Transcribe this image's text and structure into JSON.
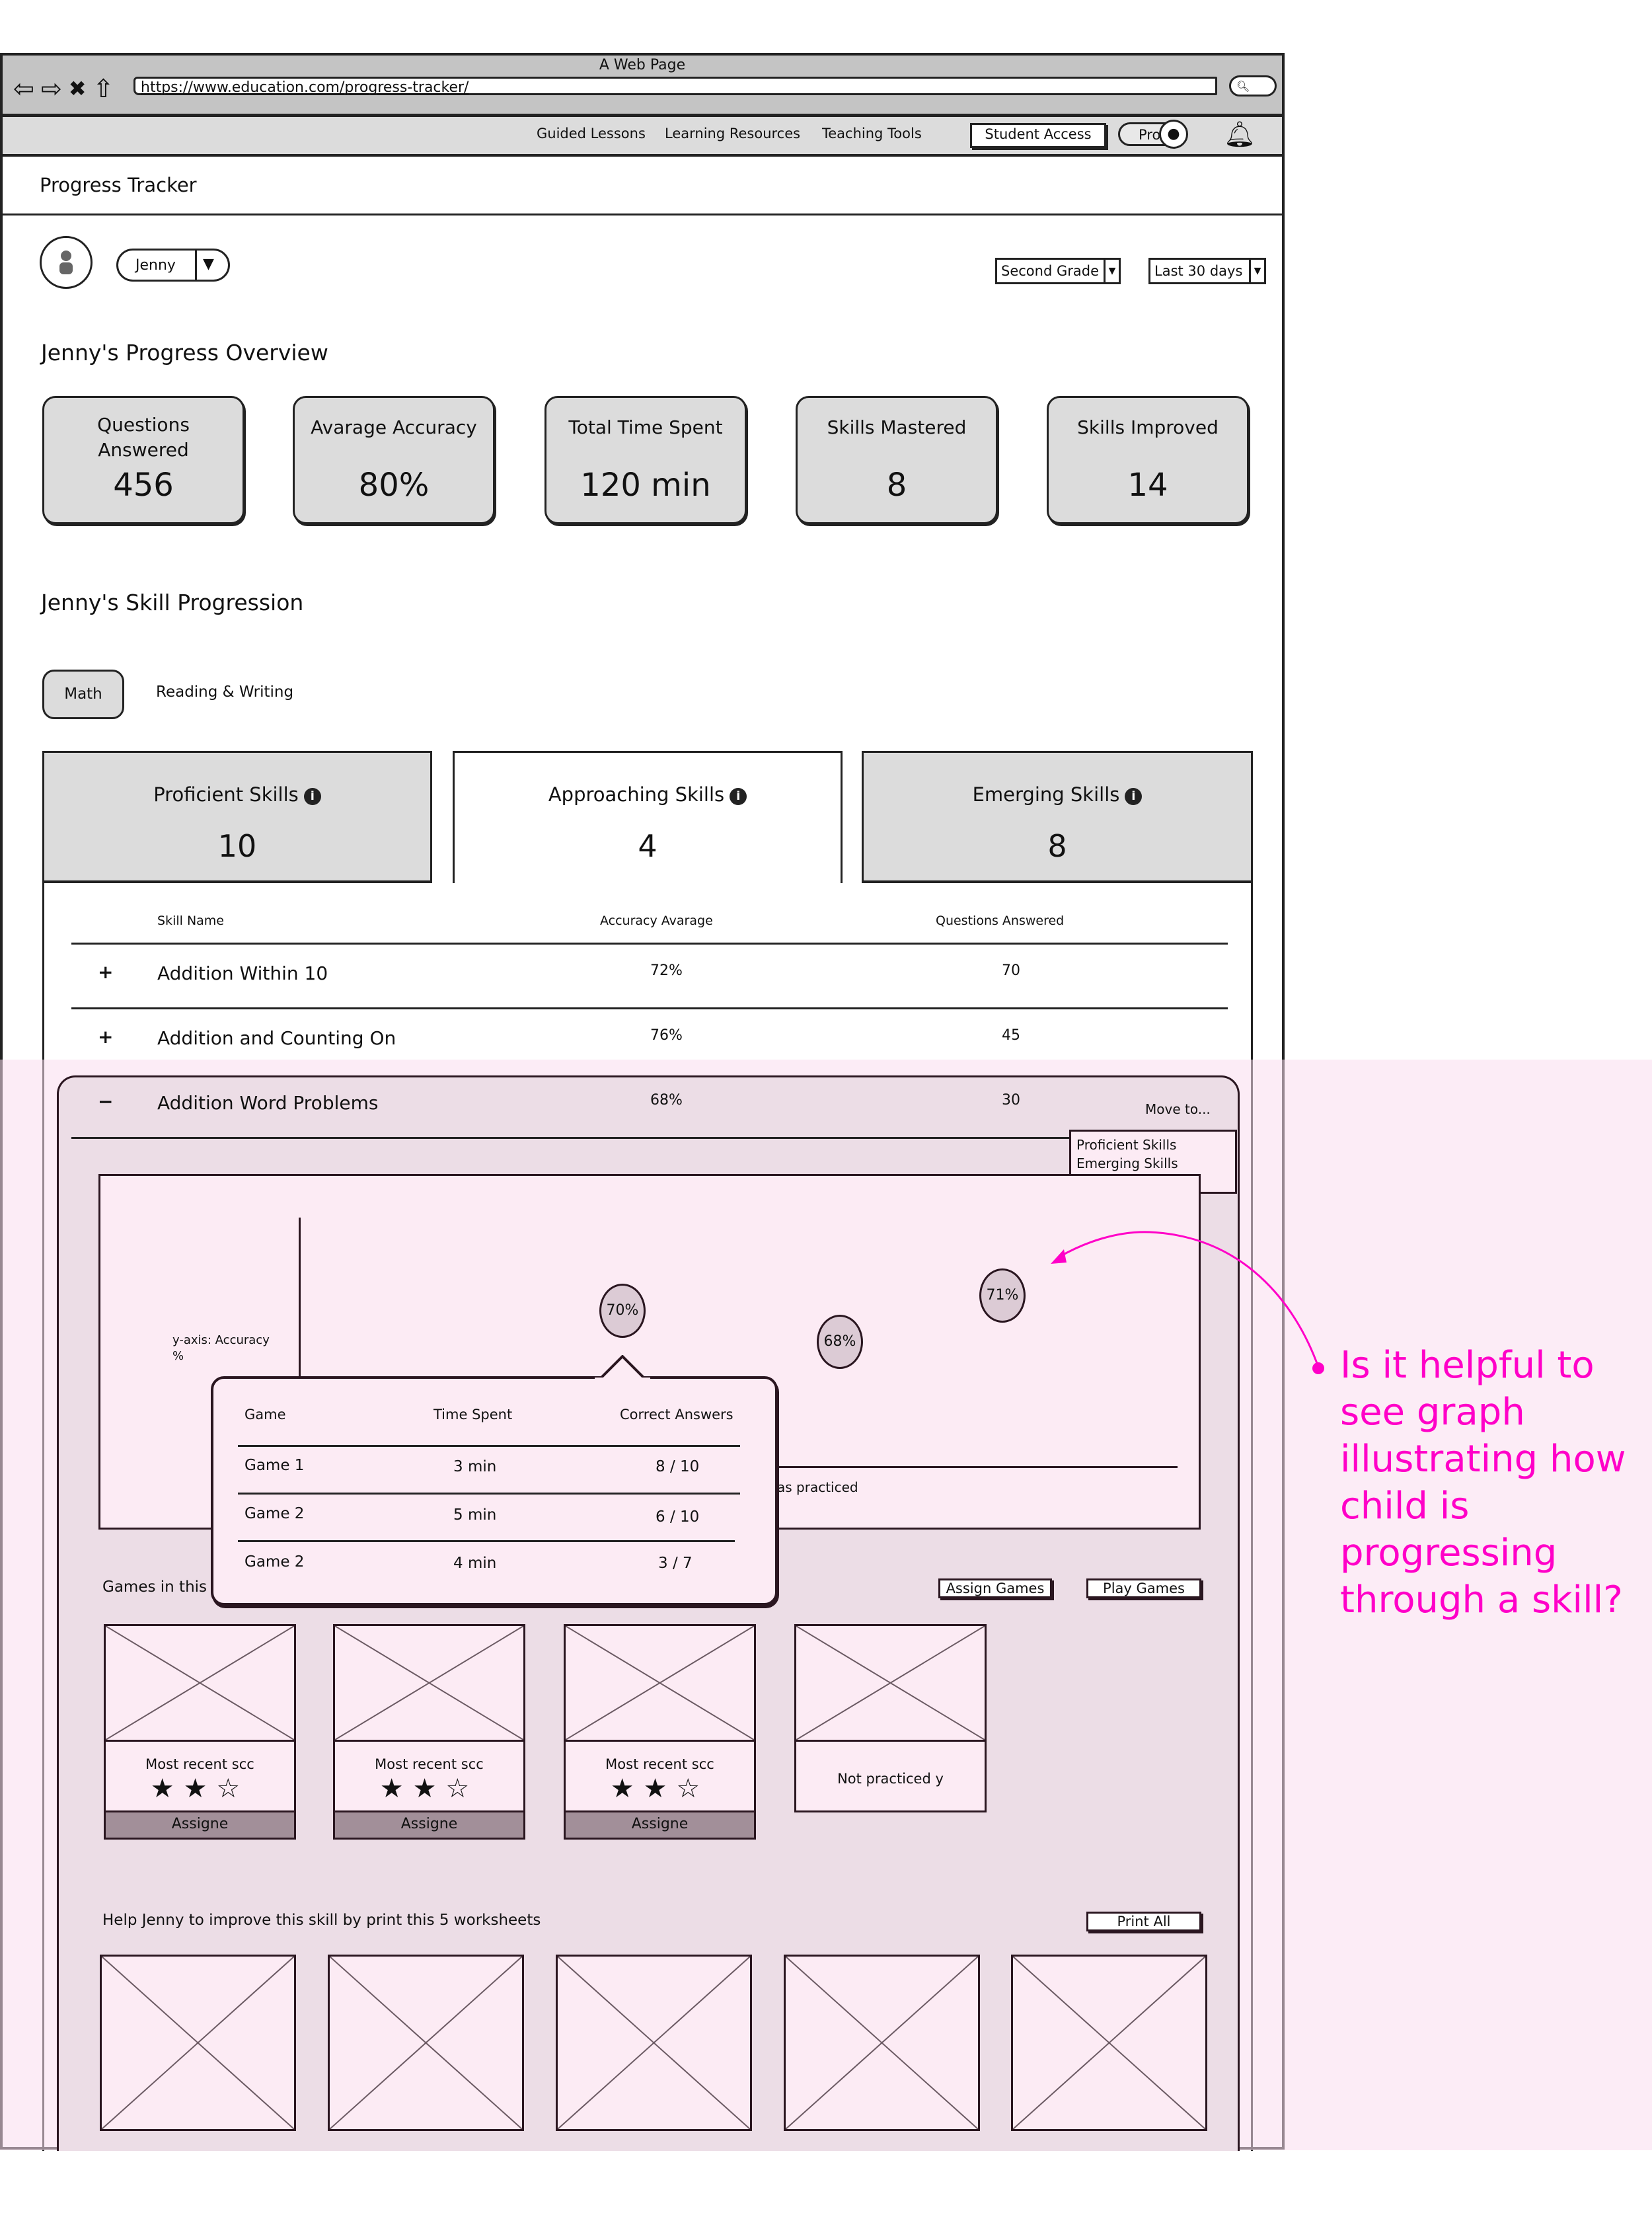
{
  "browser": {
    "window_title": "A Web Page",
    "url": "https://www.education.com/progress-tracker/",
    "nav_icons": [
      "back-arrow-icon",
      "forward-arrow-icon",
      "close-x-icon",
      "home-icon"
    ],
    "search_icon": "search-icon"
  },
  "navbar": {
    "links": [
      "Guided Lessons",
      "Learning Resources",
      "Teaching Tools"
    ],
    "student_access": "Student Access",
    "profile_label": "Pro",
    "icons": {
      "profile": "user-icon",
      "notifications": "bell-icon"
    }
  },
  "page": {
    "title": "Progress Tracker",
    "student_select": {
      "value": "Jenny"
    },
    "grade_select": {
      "value": "Second Grade"
    },
    "period_select": {
      "value": "Last 30 days"
    }
  },
  "overview": {
    "title": "Jenny's Progress Overview",
    "cards": [
      {
        "label": "Questions Answered",
        "value": "456"
      },
      {
        "label": "Avarage Accuracy",
        "value": "80%"
      },
      {
        "label": "Total Time Spent",
        "value": "120 min"
      },
      {
        "label": "Skills Mastered",
        "value": "8"
      },
      {
        "label": "Skills Improved",
        "value": "14"
      }
    ]
  },
  "skills": {
    "title": "Jenny's Skill Progression",
    "subject_tabs": [
      {
        "label": "Math",
        "active": true
      },
      {
        "label": "Reading & Writing",
        "active": false
      }
    ],
    "level_tabs": [
      {
        "label": "Proficient Skills",
        "count": "10",
        "active": false
      },
      {
        "label": "Approaching Skills",
        "count": "4",
        "active": true
      },
      {
        "label": "Emerging Skills",
        "count": "8",
        "active": false
      }
    ],
    "table": {
      "headers": [
        "Skill Name",
        "Accuracy Avarage",
        "Questions Answered"
      ],
      "rows": [
        {
          "toggle": "+",
          "name": "Addition Within 10",
          "accuracy": "72%",
          "questions": "70",
          "expanded": false
        },
        {
          "toggle": "+",
          "name": "Addition and Counting On",
          "accuracy": "76%",
          "questions": "45",
          "expanded": false
        },
        {
          "toggle": "−",
          "name": "Addition Word Problems",
          "accuracy": "68%",
          "questions": "30",
          "expanded": true
        }
      ]
    },
    "move_to": {
      "label": "Move to...",
      "options": [
        "Proficient Skills",
        "Emerging Skills"
      ]
    }
  },
  "chart_data": {
    "type": "scatter",
    "title": "",
    "ylabel": "y-axis: Accuracy %",
    "xlabel_visible_fragment": "as practiced",
    "points": [
      {
        "label": "70%",
        "value": 70,
        "order": 1
      },
      {
        "label": "68%",
        "value": 68,
        "order": 2
      },
      {
        "label": "71%",
        "value": 71,
        "order": 3
      }
    ],
    "ylim": [
      60,
      76
    ],
    "grid": false
  },
  "popover": {
    "headers": [
      "Game",
      "Time Spent",
      "Correct Answers"
    ],
    "rows": [
      {
        "game": "Game 1",
        "time": "3 min",
        "correct": "8 / 10"
      },
      {
        "game": "Game 2",
        "time": "5 min",
        "correct": "6 / 10"
      },
      {
        "game": "Game 2",
        "time": "4 min",
        "correct": "3 / 7"
      }
    ]
  },
  "games": {
    "title": "Games in this",
    "assign_button": "Assign Games",
    "play_button": "Play Games",
    "cards": [
      {
        "caption": "Most recent scc",
        "stars": 2,
        "max_stars": 3,
        "button": "Assigne"
      },
      {
        "caption": "Most recent scc",
        "stars": 2,
        "max_stars": 3,
        "button": "Assigne"
      },
      {
        "caption": "Most recent scc",
        "stars": 2,
        "max_stars": 3,
        "button": "Assigne"
      },
      {
        "caption": "Not practiced y",
        "stars": null,
        "button": null
      }
    ]
  },
  "worksheets": {
    "title": "Help Jenny to improve this skill by print this 5 worksheets",
    "print_button": "Print All",
    "count": 5
  },
  "annotation": {
    "text": "Is it helpful to see graph illustrating how child is progressing through a skill?",
    "color": "#ff00c8"
  },
  "colors": {
    "card_gray": "#dcdcdc",
    "highlight_pink": "#fcebf4",
    "expanded_bg": "#ecdde6",
    "assign_button_bg": "#a28f99"
  }
}
